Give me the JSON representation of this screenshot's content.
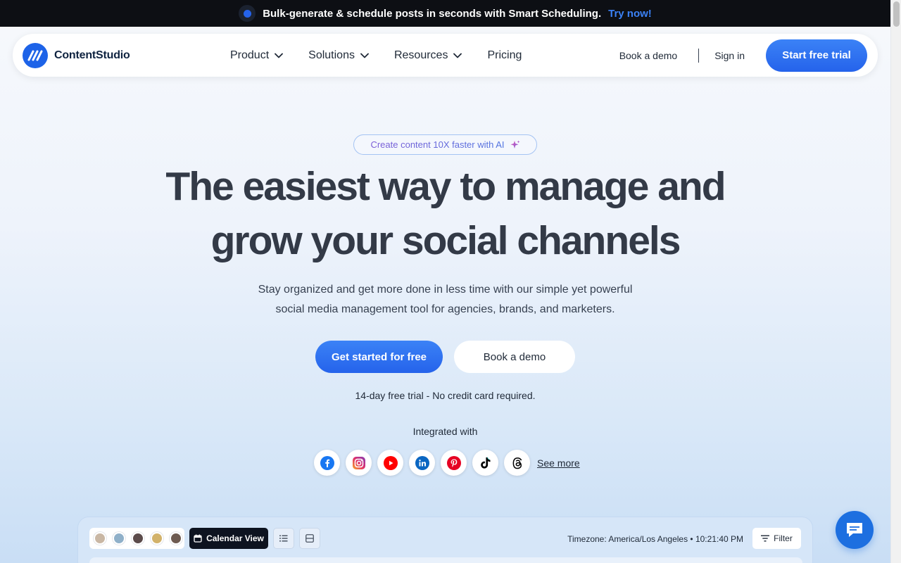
{
  "announcement": {
    "message": "Bulk-generate & schedule posts in seconds with Smart Scheduling.",
    "cta": "Try now!"
  },
  "brand": {
    "name": "ContentStudio",
    "accent": "#1d63e8"
  },
  "nav": {
    "items": [
      {
        "label": "Product",
        "has_dropdown": true
      },
      {
        "label": "Solutions",
        "has_dropdown": true
      },
      {
        "label": "Resources",
        "has_dropdown": true
      },
      {
        "label": "Pricing",
        "has_dropdown": false
      }
    ],
    "book_demo": "Book a demo",
    "sign_in": "Sign in",
    "start_trial": "Start free trial"
  },
  "hero": {
    "badge": "Create content 10X faster with AI",
    "headline_line1": "The easiest way to manage and",
    "headline_line2": "grow your social channels",
    "subtext_line1": "Stay organized and get more done in less time with our simple yet powerful",
    "subtext_line2": "social media management tool for agencies, brands, and marketers.",
    "primary_cta": "Get started for free",
    "secondary_cta": "Book a demo",
    "trial_note": "14-day free trial - No credit card required.",
    "integrated_label": "Integrated with",
    "see_more": "See more",
    "social_icons": [
      "facebook-icon",
      "instagram-icon",
      "youtube-icon",
      "linkedin-icon",
      "pinterest-icon",
      "tiktok-icon",
      "threads-icon"
    ]
  },
  "dashboard": {
    "calendar_view": "Calendar View",
    "timezone": "Timezone: America/Los Angeles • 10:21:40 PM",
    "filter": "Filter"
  }
}
